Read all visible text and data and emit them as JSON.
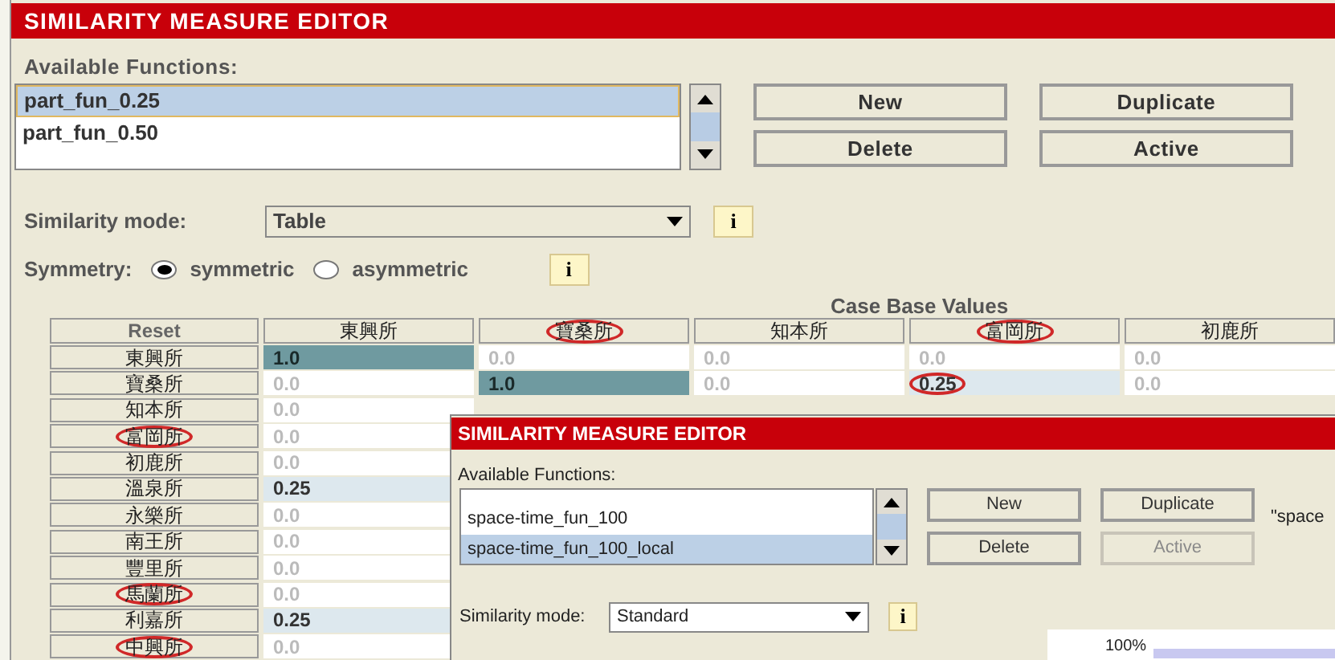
{
  "main": {
    "title": "SIMILARITY MEASURE EDITOR",
    "functions_label": "Available Functions:",
    "functions": [
      {
        "label": "part_fun_0.25",
        "selected": true
      },
      {
        "label": "part_fun_0.50",
        "selected": false
      }
    ],
    "buttons": [
      {
        "label": "New",
        "disabled": false
      },
      {
        "label": "Duplicate",
        "disabled": false
      },
      {
        "label": "Delete",
        "disabled": false
      },
      {
        "label": "Active",
        "disabled": false
      }
    ],
    "mode_label": "Similarity mode:",
    "mode_value": "Table",
    "info_mode": "i",
    "symmetry_label": "Symmetry:",
    "info_symmetry": "i",
    "symmetry": [
      {
        "label": "symmetric",
        "selected": true
      },
      {
        "label": "asymmetric",
        "selected": false
      }
    ],
    "table": {
      "title": "Case Base Values",
      "reset": "Reset",
      "columns": [
        {
          "label": "東興所",
          "circled": false
        },
        {
          "label": "寶桑所",
          "circled": true
        },
        {
          "label": "知本所",
          "circled": false
        },
        {
          "label": "富岡所",
          "circled": true
        },
        {
          "label": "初鹿所",
          "circled": false
        }
      ],
      "rows": [
        {
          "label": "東興所",
          "circled": false,
          "cells": [
            {
              "value": "1.0",
              "kind": "identity",
              "circled": false
            },
            {
              "value": "0.0",
              "kind": "zero",
              "circled": false
            },
            {
              "value": "0.0",
              "kind": "zero",
              "circled": false
            },
            {
              "value": "0.0",
              "kind": "zero",
              "circled": false
            },
            {
              "value": "0.0",
              "kind": "zero",
              "circled": false
            }
          ]
        },
        {
          "label": "寶桑所",
          "circled": false,
          "cells": [
            {
              "value": "0.0",
              "kind": "zero",
              "circled": false
            },
            {
              "value": "1.0",
              "kind": "identity",
              "circled": false
            },
            {
              "value": "0.0",
              "kind": "zero",
              "circled": false
            },
            {
              "value": "0.25",
              "kind": "partial",
              "circled": true
            },
            {
              "value": "0.0",
              "kind": "zero",
              "circled": false
            }
          ]
        },
        {
          "label": "知本所",
          "circled": false,
          "cells": [
            {
              "value": "0.0",
              "kind": "zero",
              "circled": false
            }
          ]
        },
        {
          "label": "富岡所",
          "circled": true,
          "cells": [
            {
              "value": "0.0",
              "kind": "zero",
              "circled": false
            }
          ]
        },
        {
          "label": "初鹿所",
          "circled": false,
          "cells": [
            {
              "value": "0.0",
              "kind": "zero",
              "circled": false
            }
          ]
        },
        {
          "label": "溫泉所",
          "circled": false,
          "cells": [
            {
              "value": "0.25",
              "kind": "partial",
              "circled": false
            }
          ]
        },
        {
          "label": "永樂所",
          "circled": false,
          "cells": [
            {
              "value": "0.0",
              "kind": "zero",
              "circled": false
            }
          ]
        },
        {
          "label": "南王所",
          "circled": false,
          "cells": [
            {
              "value": "0.0",
              "kind": "zero",
              "circled": false
            }
          ]
        },
        {
          "label": "豐里所",
          "circled": false,
          "cells": [
            {
              "value": "0.0",
              "kind": "zero",
              "circled": false
            }
          ]
        },
        {
          "label": "馬蘭所",
          "circled": true,
          "cells": [
            {
              "value": "0.0",
              "kind": "zero",
              "circled": false
            }
          ]
        },
        {
          "label": "利嘉所",
          "circled": false,
          "cells": [
            {
              "value": "0.25",
              "kind": "partial",
              "circled": false
            }
          ]
        },
        {
          "label": "中興所",
          "circled": true,
          "cells": [
            {
              "value": "0.0",
              "kind": "zero",
              "circled": false
            }
          ]
        }
      ]
    }
  },
  "overlay": {
    "title": "SIMILARITY MEASURE EDITOR",
    "functions_label": "Available Functions:",
    "functions": [
      {
        "label": "space-time_fun_100",
        "selected": false
      },
      {
        "label": "space-time_fun_100_local",
        "selected": true
      }
    ],
    "buttons": [
      {
        "label": "New",
        "disabled": false
      },
      {
        "label": "Duplicate",
        "disabled": false
      },
      {
        "label": "Delete",
        "disabled": false
      },
      {
        "label": "Active",
        "disabled": true
      }
    ],
    "side_text": "\"space",
    "mode_label": "Similarity mode:",
    "mode_value": "Standard",
    "info_mode": "i",
    "chart_label": "100%"
  }
}
